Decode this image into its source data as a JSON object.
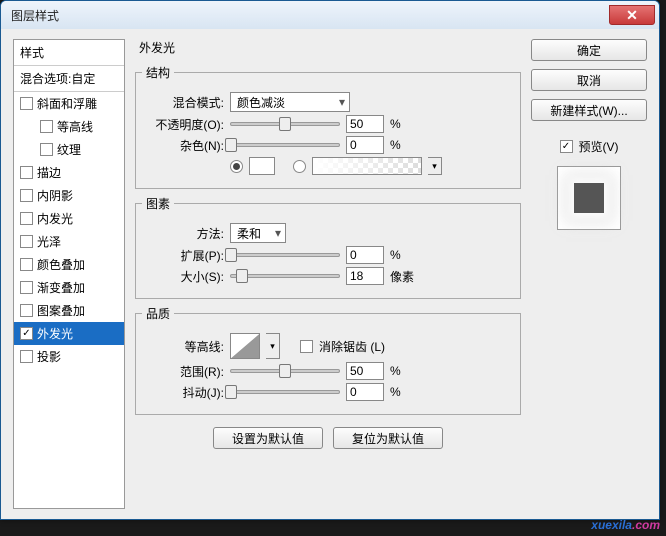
{
  "window": {
    "title": "图层样式",
    "close": "✕"
  },
  "left": {
    "header": "样式",
    "blend": "混合选项:自定",
    "items": [
      {
        "label": "斜面和浮雕",
        "checked": false,
        "indent": false
      },
      {
        "label": "等高线",
        "checked": false,
        "indent": true
      },
      {
        "label": "纹理",
        "checked": false,
        "indent": true
      },
      {
        "label": "描边",
        "checked": false,
        "indent": false
      },
      {
        "label": "内阴影",
        "checked": false,
        "indent": false
      },
      {
        "label": "内发光",
        "checked": false,
        "indent": false
      },
      {
        "label": "光泽",
        "checked": false,
        "indent": false
      },
      {
        "label": "颜色叠加",
        "checked": false,
        "indent": false
      },
      {
        "label": "渐变叠加",
        "checked": false,
        "indent": false
      },
      {
        "label": "图案叠加",
        "checked": false,
        "indent": false
      },
      {
        "label": "外发光",
        "checked": true,
        "indent": false,
        "selected": true
      },
      {
        "label": "投影",
        "checked": false,
        "indent": false
      }
    ]
  },
  "mid": {
    "title": "外发光",
    "structure": {
      "legend": "结构",
      "blend_label": "混合模式:",
      "blend_value": "颜色减淡",
      "opacity_label": "不透明度(O):",
      "opacity_value": "50",
      "opacity_unit": "%",
      "opacity_pct": 50,
      "noise_label": "杂色(N):",
      "noise_value": "0",
      "noise_unit": "%",
      "noise_pct": 0
    },
    "elements": {
      "legend": "图素",
      "method_label": "方法:",
      "method_value": "柔和",
      "spread_label": "扩展(P):",
      "spread_value": "0",
      "spread_unit": "%",
      "spread_pct": 0,
      "size_label": "大小(S):",
      "size_value": "18",
      "size_unit": "像素",
      "size_pct": 10
    },
    "quality": {
      "legend": "品质",
      "contour_label": "等高线:",
      "antialias_label": "消除锯齿 (L)",
      "range_label": "范围(R):",
      "range_value": "50",
      "range_unit": "%",
      "range_pct": 50,
      "jitter_label": "抖动(J):",
      "jitter_value": "0",
      "jitter_unit": "%",
      "jitter_pct": 0
    },
    "defaults_set": "设置为默认值",
    "defaults_reset": "复位为默认值"
  },
  "right": {
    "ok": "确定",
    "cancel": "取消",
    "new_style": "新建样式(W)...",
    "preview_label": "预览(V)"
  },
  "watermark": {
    "a": "xuexila",
    "b": ".com"
  }
}
